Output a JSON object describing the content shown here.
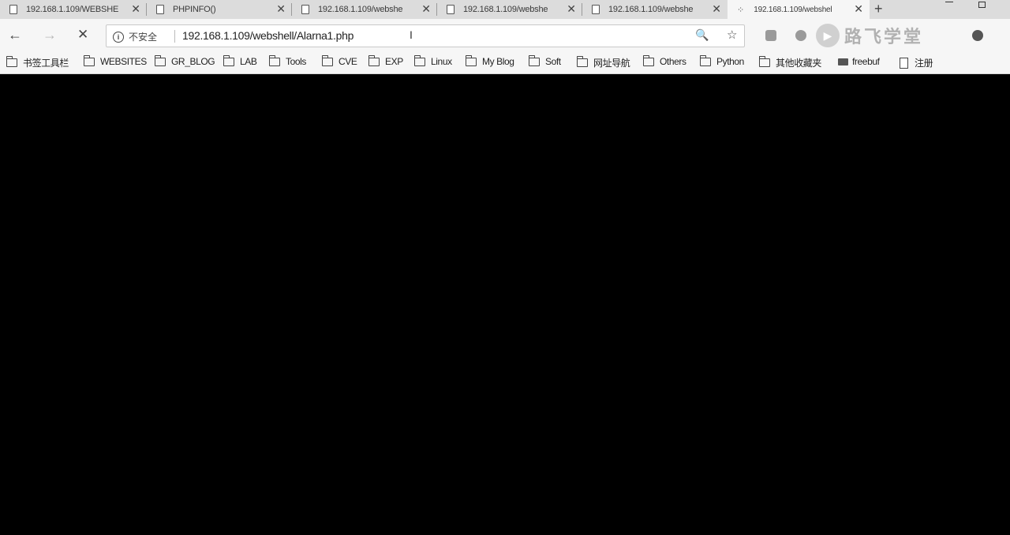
{
  "tabs": [
    {
      "title": "192.168.1.109/WEBSHE",
      "close": "✕"
    },
    {
      "title": "PHPINFO()",
      "close": "✕"
    },
    {
      "title": "192.168.1.109/webshe",
      "close": "✕"
    },
    {
      "title": "192.168.1.109/webshe",
      "close": "✕"
    },
    {
      "title": "192.168.1.109/webshe",
      "close": "✕"
    },
    {
      "title": "192.168.1.109/webshel",
      "close": "✕",
      "loading_glyph": "⁘"
    }
  ],
  "new_tab": "+",
  "toolbar": {
    "back": "←",
    "forward": "→",
    "stop": "✕",
    "security_label": "不安全",
    "url": "192.168.1.109/webshell/Alarna1.php",
    "zoom_glyph": "🔍",
    "star_glyph": "☆"
  },
  "watermark": {
    "text": "路飞学堂",
    "play_glyph": "▶"
  },
  "bookmarks": [
    {
      "label": "书签工具栏"
    },
    {
      "label": "WEBSITES"
    },
    {
      "label": "GR_BLOG"
    },
    {
      "label": "LAB"
    },
    {
      "label": "Tools"
    },
    {
      "label": "CVE"
    },
    {
      "label": "EXP"
    },
    {
      "label": "Linux"
    },
    {
      "label": "My Blog"
    },
    {
      "label": "Soft"
    },
    {
      "label": "网址导航"
    },
    {
      "label": "Others"
    },
    {
      "label": "Python"
    },
    {
      "label": "其他收藏夹"
    },
    {
      "label": "freebuf"
    },
    {
      "label": "注册"
    }
  ]
}
